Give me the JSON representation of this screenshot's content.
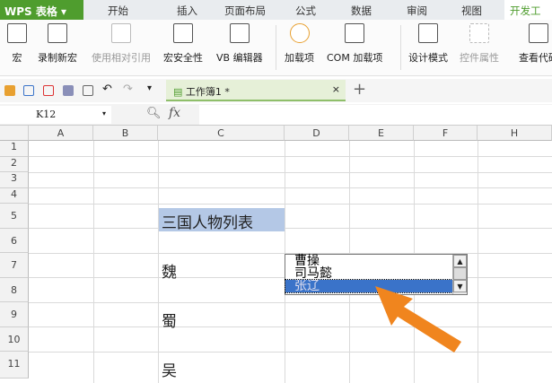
{
  "app": {
    "logo": "WPS 表格"
  },
  "menu_tabs": [
    "开始",
    "插入",
    "页面布局",
    "公式",
    "数据",
    "审阅",
    "视图",
    "开发工具"
  ],
  "ribbon": [
    {
      "label": "宏",
      "disabled": false
    },
    {
      "label": "录制新宏",
      "disabled": false
    },
    {
      "label": "使用相对引用",
      "disabled": true
    },
    {
      "label": "宏安全性",
      "disabled": false
    },
    {
      "label": "VB 编辑器",
      "disabled": false
    },
    {
      "label": "加载项",
      "disabled": false
    },
    {
      "label": "COM 加载项",
      "disabled": false
    },
    {
      "label": "设计模式",
      "disabled": false
    },
    {
      "label": "控件属性",
      "disabled": true
    },
    {
      "label": "查看代码",
      "disabled": false
    }
  ],
  "doc_tab": {
    "title": "工作簿1 *",
    "close": "×",
    "add": "+"
  },
  "formula_bar": {
    "name_box": "K12",
    "fx": "fx",
    "value": ""
  },
  "columns": [
    "A",
    "B",
    "C",
    "D",
    "E",
    "F",
    "H"
  ],
  "rows": [
    "1",
    "2",
    "3",
    "4",
    "5",
    "6",
    "7",
    "8",
    "9",
    "10",
    "11"
  ],
  "cells": {
    "C5": "三国人物列表",
    "C7": "魏",
    "C9": "蜀",
    "C11": "吴"
  },
  "listbox": {
    "items": [
      "曹操",
      "司马懿",
      "张辽"
    ],
    "selected": "张辽"
  },
  "colors": {
    "accent": "#4f9d2e",
    "header_fill": "#b4c8e6",
    "selection": "#3a73c9",
    "arrow": "#f0851e"
  }
}
